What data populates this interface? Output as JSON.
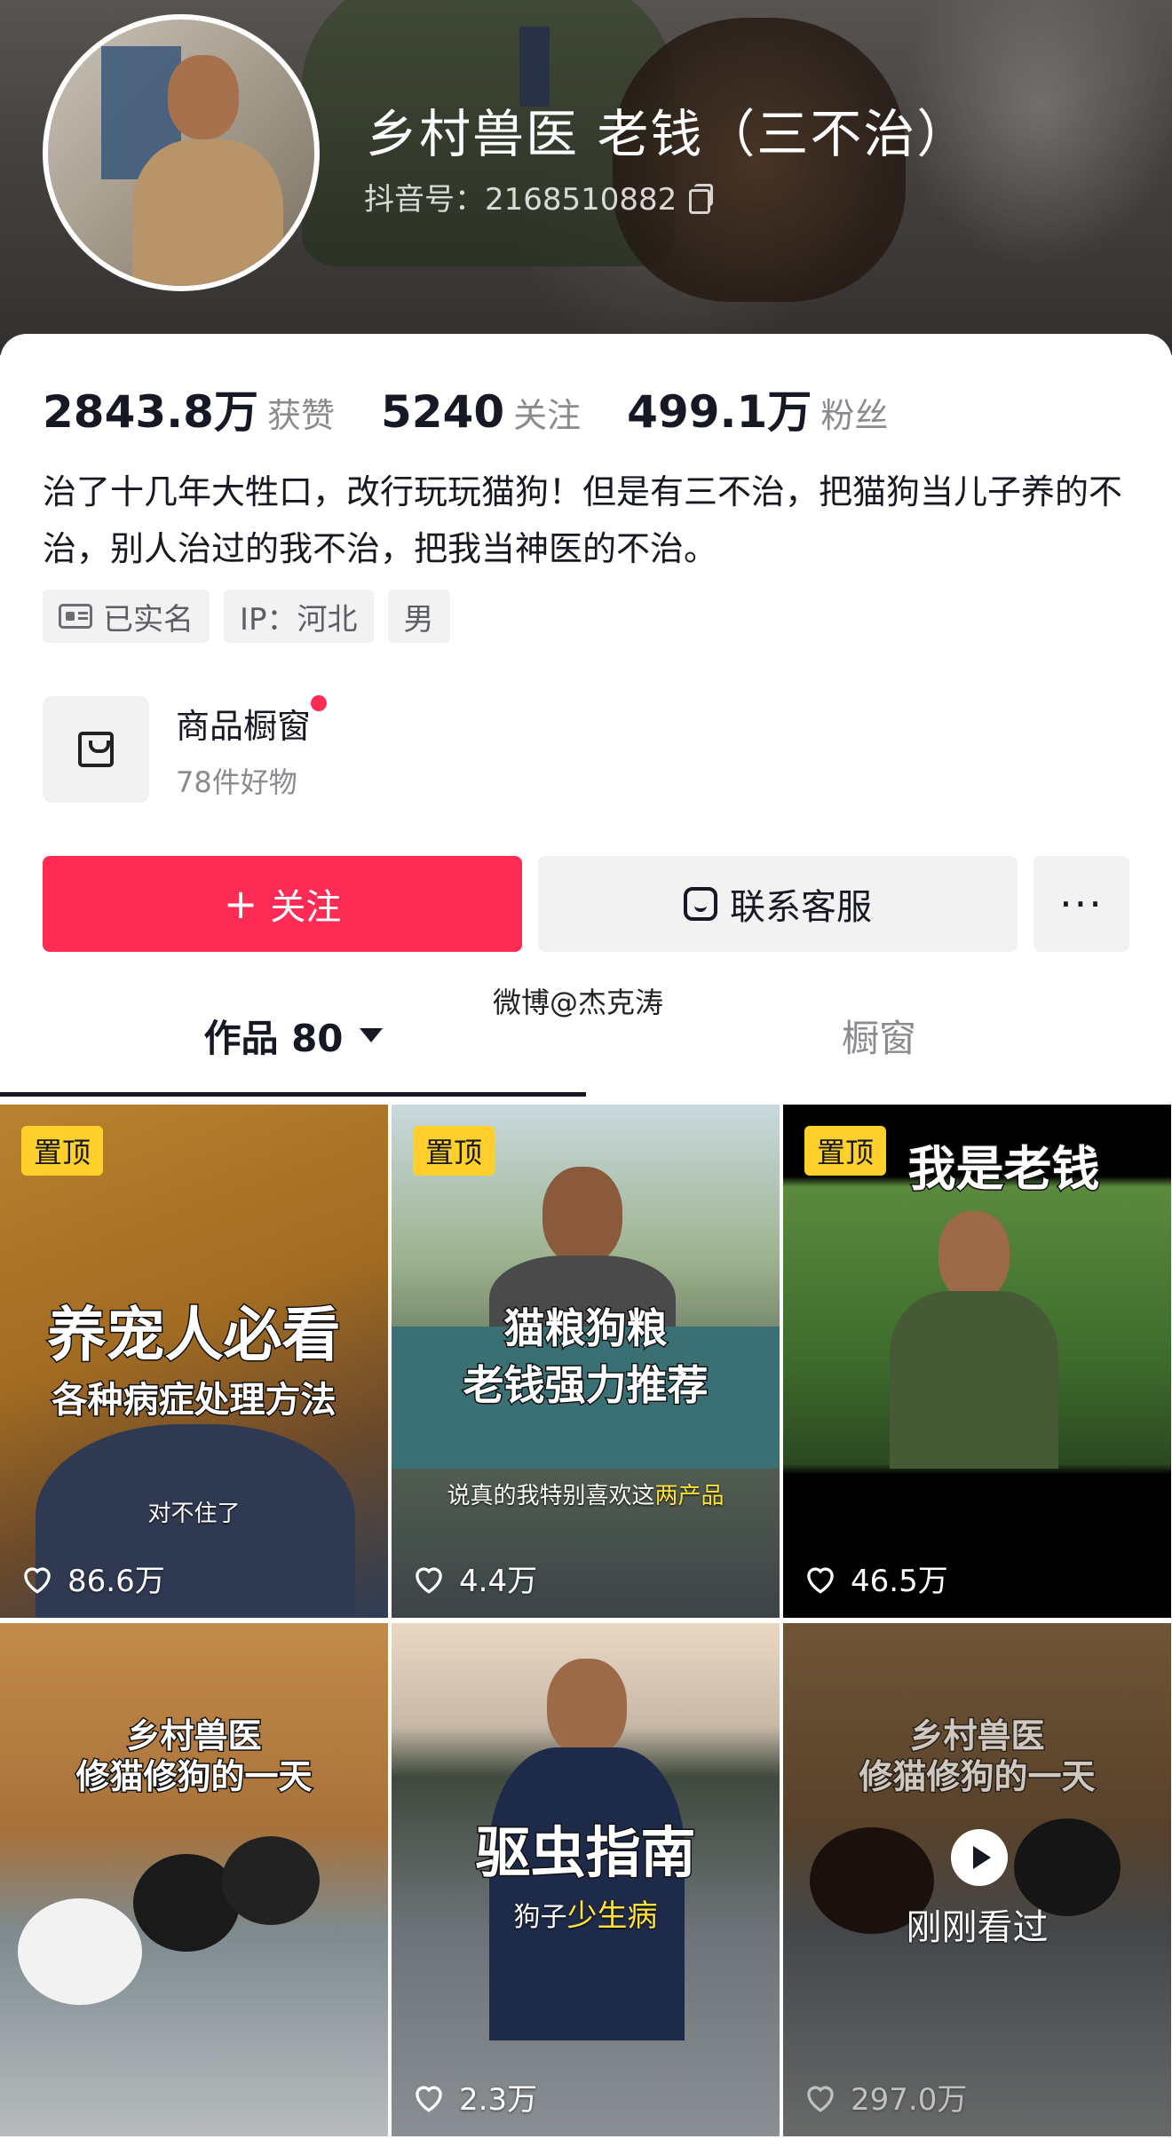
{
  "profile": {
    "name": "乡村兽医  老钱（三不治）",
    "douyin_id": "抖音号：2168510882"
  },
  "stats": [
    {
      "value": "2843.8万",
      "label": "获赞"
    },
    {
      "value": "5240",
      "label": "关注"
    },
    {
      "value": "499.1万",
      "label": "粉丝"
    }
  ],
  "bio": "治了十几年大牲口，改行玩玩猫狗！但是有三不治，把猫狗当儿子养的不治，别人治过的我不治，把我当神医的不治。",
  "tags": [
    "已实名",
    "IP：河北",
    "男"
  ],
  "shop": {
    "title": "商品橱窗",
    "subtitle": "78件好物"
  },
  "actions": {
    "follow": "关注",
    "contact": "联系客服",
    "more": "···"
  },
  "tabs": {
    "works": "作品 80",
    "shop": "橱窗"
  },
  "videos": [
    {
      "pin": "置顶",
      "title1": "养宠人必看",
      "title2": "各种病症处理方法",
      "caption": "对不住了",
      "likes": "86.6万"
    },
    {
      "pin": "置顶",
      "title1": "猫粮狗粮",
      "title2": "老钱强力推荐",
      "caption_pre": "说真的我特别喜欢这",
      "caption_hl": "两产品",
      "likes": "4.4万"
    },
    {
      "pin": "置顶",
      "title1": "我是老钱",
      "likes": "46.5万"
    },
    {
      "title1": "乡村兽医",
      "title2": "修猫修狗的一天"
    },
    {
      "title1": "驱虫指南",
      "caption_pre": "狗子",
      "caption_hl": "少生病",
      "likes": "2.3万"
    },
    {
      "title1": "乡村兽医",
      "title2": "修猫修狗的一天",
      "recent": "刚刚看过",
      "likes": "297.0万"
    }
  ],
  "watermark": "微博@杰克涛",
  "colors": {
    "accent": "#fe2c55",
    "pin": "#ffd02b",
    "tab_active": "#161823"
  }
}
